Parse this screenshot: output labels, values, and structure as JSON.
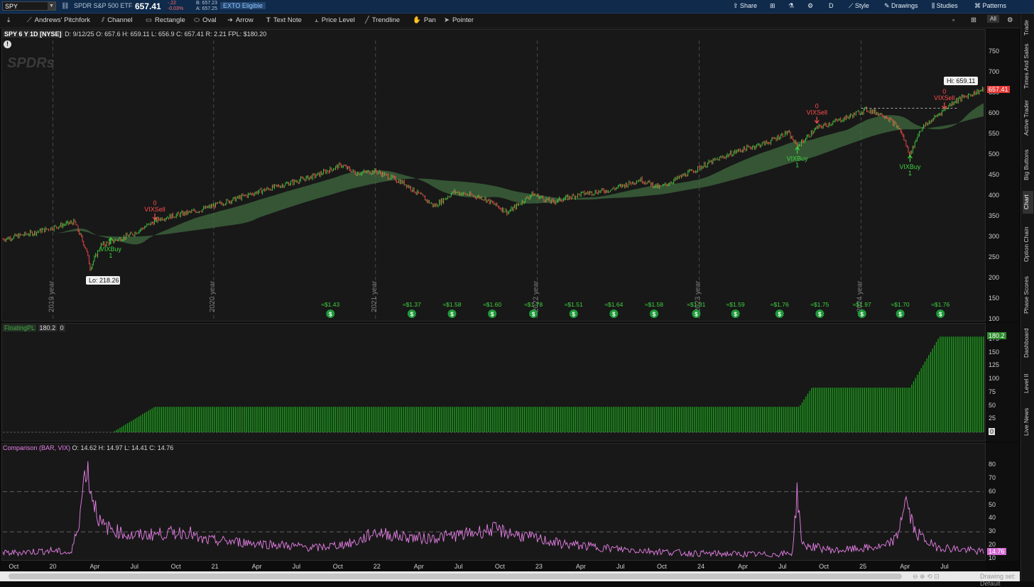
{
  "colors": {
    "accent": "#0f2a4a",
    "price_up": "#3fd13f",
    "price_down": "#ff4d4d",
    "vix": "#e67fe6",
    "price_tag": "#e53935",
    "pl_tag": "#2e8b2e",
    "vix_tag": "#d36ad3"
  },
  "topbar": {
    "symbol": "SPY",
    "dropdown_icon": "chevron-down-icon",
    "company": "SPDR S&P 500 ETF",
    "last": "657.41",
    "change": "-.22",
    "change_pct": "-0.03%",
    "bid": "B: 657.23",
    "ask": "A: 657.25",
    "exto": "EXTO Eligible",
    "share": "Share",
    "timeframe": "D",
    "style": "Style",
    "drawings": "Drawings",
    "studies": "Studies",
    "patterns": "Patterns"
  },
  "drawbar": {
    "tools": [
      "Andrews' Pitchfork",
      "Channel",
      "Rectangle",
      "Oval",
      "Arrow",
      "Text Note",
      "Price Level",
      "Trendline",
      "Pan",
      "Pointer"
    ],
    "all_label": "All"
  },
  "rail": {
    "tabs": [
      "Trade",
      "Times And Sales",
      "Active Trader",
      "Big Buttons",
      "Chart",
      "Option Chain",
      "Phase Scores",
      "Dashboard",
      "Level II",
      "Live News"
    ],
    "active": "Chart"
  },
  "main": {
    "header": {
      "symbol": "SPY 6 Y 1D [NYSE]",
      "date": "D: 9/12/25",
      "open": "O: 657.6",
      "high": "H: 659.11",
      "low": "L: 656.9",
      "close": "C: 657.41",
      "range": "R: 2.21",
      "fpl": "FPL: $180.20"
    },
    "watermark": "SPDRs",
    "hi_label": "Hi: 659.11",
    "lo_label": "Lo: 218.26",
    "price_tag": "657.41",
    "y_ticks": [
      "750",
      "700",
      "650",
      "600",
      "550",
      "500",
      "450",
      "400",
      "350",
      "300",
      "250",
      "200",
      "150",
      "100"
    ],
    "year_markers": [
      "2019 year",
      "2020 year",
      "2021 year",
      "2022 year",
      "2023 year",
      "2024 year"
    ],
    "dividends": [
      "≈$1.43",
      "≈$1.37",
      "≈$1.58",
      "≈$1.60",
      "≈$1.78",
      "≈$1.51",
      "≈$1.64",
      "≈$1.58",
      "≈$1.31",
      "≈$1.59",
      "≈$1.76",
      "≈$1.75",
      "≈$1.97",
      "≈$1.70",
      "≈$1.76"
    ],
    "signals": [
      {
        "type": "VIXSell",
        "count": "0",
        "dir": "down"
      },
      {
        "type": "VIXBuy",
        "count": "1",
        "dir": "up"
      },
      {
        "type": "VIXSell",
        "count": "0",
        "dir": "down"
      },
      {
        "type": "VIXBuy",
        "count": "1",
        "dir": "up"
      },
      {
        "type": "VIXBuy",
        "count": "1",
        "dir": "up"
      },
      {
        "type": "VIXSell",
        "count": "0",
        "dir": "down"
      }
    ]
  },
  "pl": {
    "header_name": "FloatingPL",
    "header_val": "180.2",
    "header_zero": "0",
    "tag": "180.2",
    "zero_tag": "0",
    "y_ticks": [
      "175",
      "150",
      "125",
      "100",
      "75",
      "50",
      "25"
    ]
  },
  "vix": {
    "header": {
      "name": "Comparison (BAR, VIX)",
      "open": "O: 14.62",
      "high": "H: 14.97",
      "low": "L: 14.41",
      "close": "C: 14.76"
    },
    "tag": "14.76",
    "y_ticks": [
      "80",
      "70",
      "60",
      "50",
      "40",
      "30",
      "20",
      "10"
    ]
  },
  "xaxis": {
    "labels": [
      "Oct",
      "20",
      "Apr",
      "Jul",
      "Oct",
      "21",
      "Apr",
      "Jul",
      "Oct",
      "22",
      "Apr",
      "Jul",
      "Oct",
      "23",
      "Apr",
      "Jul",
      "Oct",
      "24",
      "Apr",
      "Jul",
      "Oct",
      "25",
      "Apr",
      "Jul"
    ]
  },
  "statusbar": {
    "drawing_set": "Drawing set: Default"
  }
}
